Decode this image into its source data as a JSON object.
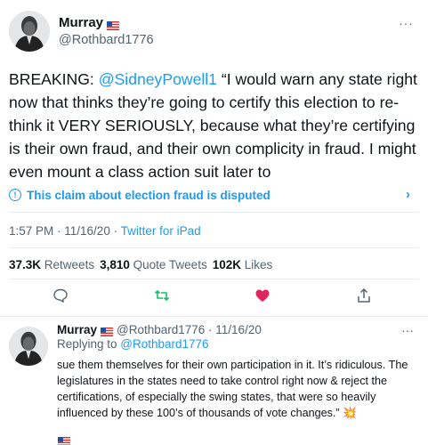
{
  "tweet": {
    "author_name": "Murray",
    "author_handle": "@Rothbard1776",
    "more_icon": "more-dots",
    "text_prefix": "BREAKING: ",
    "mention": "@SidneyPowell1",
    "text_rest": " “I would warn any state right now that thinks they’re going to certify this election to re-think it VERY SERIOUSLY, because what they’re certifying is their own fraud, and their own complicity in fraud. I might even mount a class action suit later to",
    "disputed_label": "This claim about election fraud is disputed",
    "time": "1:57 PM · 11/16/20 · ",
    "source": "Twitter for iPad",
    "retweets_count": "37.3K",
    "retweets_label": "Retweets",
    "quotes_count": "3,810",
    "quotes_label": "Quote Tweets",
    "likes_count": "102K",
    "likes_label": "Likes"
  },
  "reply": {
    "author_name": "Murray",
    "meta": "@Rothbard1776 · 11/16/20",
    "replying_prefix": "Replying to ",
    "replying_to": "@Rothbard1776",
    "text": "sue them themselves for their own participation in it. It’s ridiculous. The legislatures in the states need to take control right now & reject the certifications, of especially the swing states, that were so heavily influenced by these 100’s of thousands of vote changes.” 💥"
  },
  "colors": {
    "link": "#1d9bf0",
    "muted": "#536471",
    "like": "#e0245e",
    "retweet": "#17bf63"
  }
}
